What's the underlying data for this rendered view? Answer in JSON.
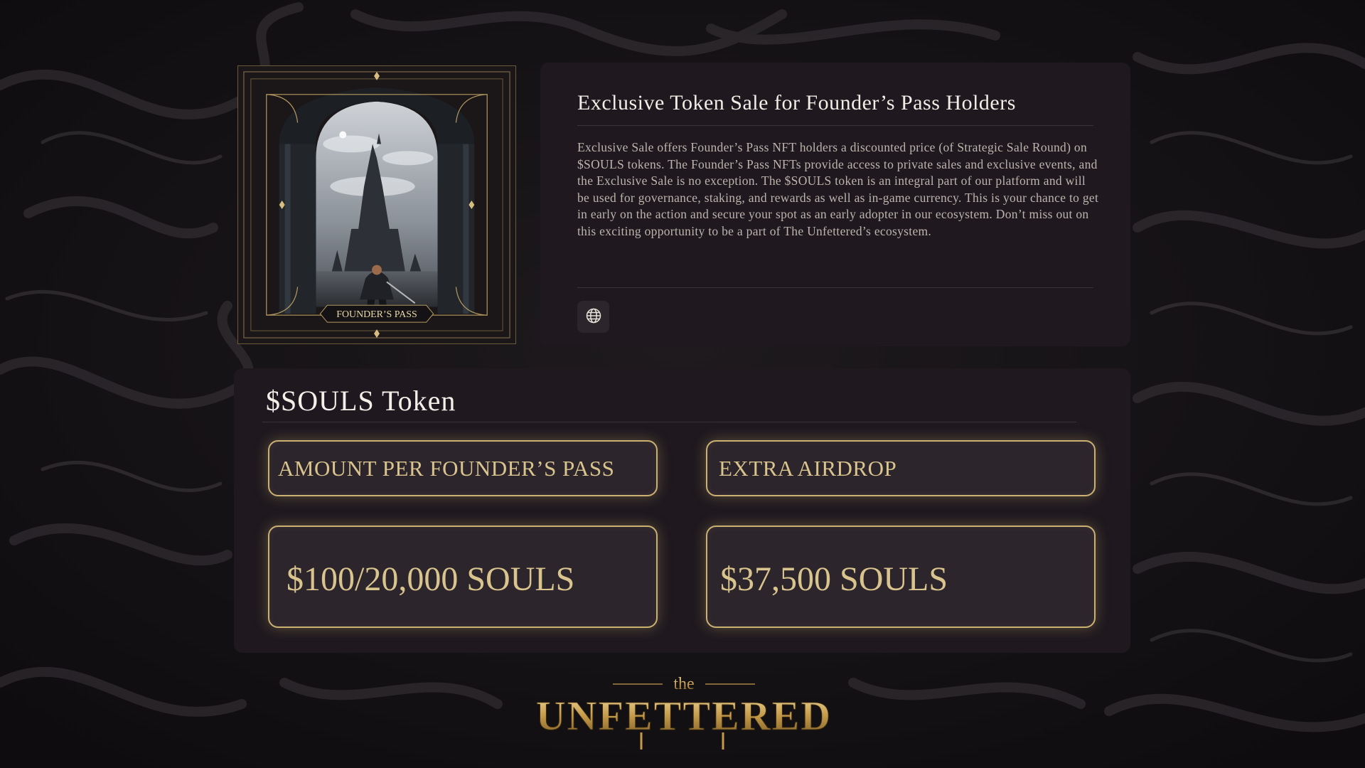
{
  "info": {
    "title": "Exclusive Token Sale for Founder’s Pass Holders",
    "description": "Exclusive Sale offers Founder’s Pass NFT holders a discounted price (of Strategic Sale Round) on $SOULS tokens. The Founder’s Pass NFTs provide access to private sales and exclusive events, and the Exclusive Sale is no exception. The $SOULS token is an integral part of our platform and will be used for governance, staking, and rewards as well as in-game currency. This is your chance to get in early on the action and secure your spot as an early adopter in our ecosystem. Don’t miss out on this exciting opportunity to be a part of The Unfettered’s ecosystem.",
    "website_icon": "globe-icon"
  },
  "pass_card": {
    "label": "FOUNDER’S PASS"
  },
  "token": {
    "title": "$SOULS Token",
    "amount_label": "AMOUNT PER FOUNDER’S PASS",
    "airdrop_label": "EXTRA AIRDROP",
    "amount_value": "$100/20,000 SOULS",
    "airdrop_value": "$37,500 SOULS"
  },
  "logo": {
    "small": "the",
    "main": "UNFETTERED"
  },
  "colors": {
    "gold": "#cbb171",
    "panel": "#1f191f",
    "background": "#141114"
  }
}
